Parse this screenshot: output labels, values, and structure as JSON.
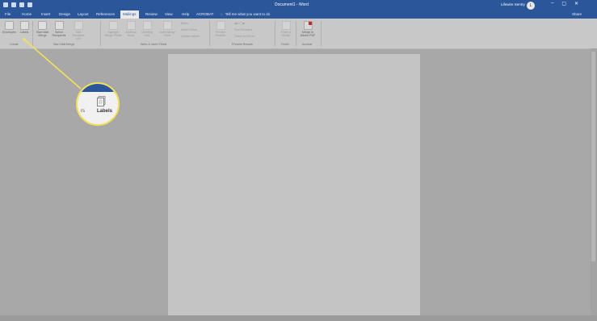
{
  "window": {
    "title": "Document1 - Word",
    "user": "Lifewire Sentry",
    "user_initial": "L",
    "controls": [
      "–",
      "▢",
      "✕"
    ]
  },
  "tabs": [
    "File",
    "Home",
    "Insert",
    "Design",
    "Layout",
    "References",
    "Mailings",
    "Review",
    "View",
    "Help",
    "ACROBAT"
  ],
  "active_tab": "Mailings",
  "tell_me": "Tell me what you want to do",
  "share": "Share",
  "ribbon": {
    "create": {
      "label": "Create",
      "envelopes": "Envelopes",
      "labels": "Labels"
    },
    "start_mail_merge": {
      "label": "Start Mail Merge",
      "start": "Start Mail Merge",
      "select": "Select Recipients",
      "edit": "Edit Recipient List"
    },
    "write_insert": {
      "label": "Write & Insert Fields",
      "highlight": "Highlight Merge Fields",
      "address": "Address Block",
      "greeting": "Greeting Line",
      "insert_field": "Insert Merge Field",
      "rules": "Rules",
      "match": "Match Fields",
      "update": "Update Labels"
    },
    "preview": {
      "label": "Preview Results",
      "preview": "Preview Results",
      "find": "Find Recipient",
      "check": "Check for Errors"
    },
    "finish": {
      "label": "Finish",
      "finish": "Finish & Merge"
    },
    "acrobat": {
      "label": "Acrobat",
      "merge": "Merge to Adobe PDF"
    }
  },
  "callout": {
    "prev_text": "rs",
    "label": "Labels",
    "highlight_color": "#f3e05a"
  },
  "colors": {
    "accent": "#2b579a",
    "ribbon": "#c8c8c8",
    "background": "#a8a8a8"
  }
}
